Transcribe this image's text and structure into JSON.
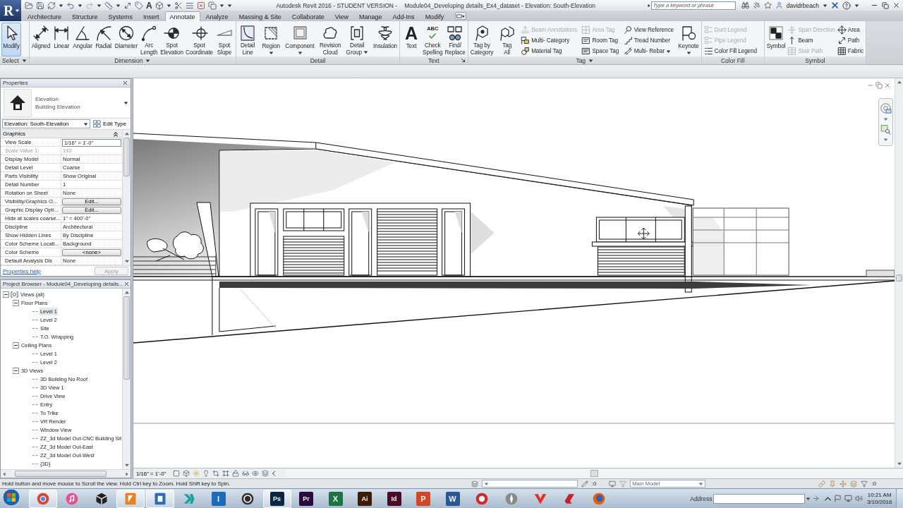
{
  "title_bar": {
    "app_glyph": "R",
    "text_tool_glyph": "A",
    "app_title": "Autodesk Revit 2016 - STUDENT VERSION -",
    "document_title": "Module04_Developing details_Ex4_dataset - Elevation: South-Elevation",
    "search": {
      "placeholder": "Type a keyword or phrase"
    },
    "user": "davidrbeach"
  },
  "tabs": [
    {
      "label": "Architecture",
      "selected": false
    },
    {
      "label": "Structure",
      "selected": false
    },
    {
      "label": "Systems",
      "selected": false
    },
    {
      "label": "Insert",
      "selected": false
    },
    {
      "label": "Annotate",
      "selected": true
    },
    {
      "label": "Analyze",
      "selected": false
    },
    {
      "label": "Massing & Site",
      "selected": false
    },
    {
      "label": "Collaborate",
      "selected": false
    },
    {
      "label": "View",
      "selected": false
    },
    {
      "label": "Manage",
      "selected": false
    },
    {
      "label": "Add-Ins",
      "selected": false
    },
    {
      "label": "Modify",
      "selected": false
    }
  ],
  "ribbon": [
    {
      "title": "Select",
      "menu": true,
      "buttons": [
        {
          "kind": "large",
          "label": "Modify",
          "pressed": true
        }
      ]
    },
    {
      "title": "Dimension",
      "menu": true,
      "buttons": [
        {
          "kind": "large",
          "label": "Aligned"
        },
        {
          "kind": "large",
          "label": "Linear"
        },
        {
          "kind": "large",
          "label": "Angular"
        },
        {
          "kind": "large",
          "label": "Radial"
        },
        {
          "kind": "large",
          "label": "Diameter"
        },
        {
          "kind": "large",
          "label": "Arc\nLength"
        },
        {
          "kind": "large",
          "label": "Spot\nElevation"
        },
        {
          "kind": "large",
          "label": "Spot\nCoordinate"
        },
        {
          "kind": "large",
          "label": "Spot\nSlope"
        }
      ]
    },
    {
      "title": "Detail",
      "buttons": [
        {
          "kind": "large",
          "label": "Detail\nLine"
        },
        {
          "kind": "large",
          "label": "Region",
          "dropdown": true
        },
        {
          "kind": "large",
          "label": "Component",
          "dropdown": true
        },
        {
          "kind": "large",
          "label": "Revision\nCloud"
        },
        {
          "kind": "large",
          "label": "Detail\nGroup",
          "dropdown": true
        },
        {
          "kind": "large",
          "label": "Insulation"
        }
      ]
    },
    {
      "title": "Text",
      "launcher": true,
      "buttons": [
        {
          "kind": "glyph",
          "glyph": "A",
          "label": "Text"
        },
        {
          "kind": "glyph",
          "glyph": "ABC",
          "label": "Check\nSpelling"
        },
        {
          "kind": "large",
          "label": "Find/\nReplace"
        }
      ]
    },
    {
      "title": "Tag",
      "menu": true,
      "buttons": [
        {
          "kind": "large",
          "label": "Tag by\nCategory",
          "disabled": false
        },
        {
          "kind": "large",
          "label": "Tag\nAll",
          "disabled": false
        },
        {
          "kind": "small",
          "label": "Beam Annotations",
          "disabled": true
        },
        {
          "kind": "small",
          "label": "Multi- Category",
          "disabled": false
        },
        {
          "kind": "small",
          "label": "Material Tag",
          "disabled": false
        },
        {
          "kind": "small",
          "label": "Area Tag",
          "disabled": true
        },
        {
          "kind": "small",
          "label": "Room Tag",
          "disabled": false
        },
        {
          "kind": "small",
          "label": "Space Tag",
          "disabled": false
        },
        {
          "kind": "small",
          "label": "View Reference",
          "disabled": false
        },
        {
          "kind": "small",
          "label": "Tread Number",
          "disabled": false
        },
        {
          "kind": "small",
          "label": "Multi- Rebar",
          "disabled": false,
          "dropdown": true
        },
        {
          "kind": "large",
          "label": "Keynote",
          "disabled": false,
          "dropdown": true
        }
      ]
    },
    {
      "title": "Color Fill",
      "buttons": [
        {
          "kind": "small",
          "label": "Duct Legend",
          "disabled": true
        },
        {
          "kind": "small",
          "label": "Pipe Legend",
          "disabled": true
        },
        {
          "kind": "small",
          "label": "Color Fill Legend",
          "disabled": false
        }
      ]
    },
    {
      "title": "Symbol",
      "buttons": [
        {
          "kind": "large",
          "label": "Symbol",
          "disabled": false
        },
        {
          "kind": "small",
          "label": "Span Direction",
          "disabled": true
        },
        {
          "kind": "small",
          "label": "Beam",
          "disabled": false
        },
        {
          "kind": "small",
          "label": "Stair Path",
          "disabled": true
        },
        {
          "kind": "small",
          "label": "Area",
          "disabled": false
        },
        {
          "kind": "small",
          "label": "Path",
          "disabled": false
        },
        {
          "kind": "small",
          "label": "Fabric",
          "disabled": false
        }
      ]
    }
  ],
  "properties": {
    "title": "Properties",
    "type_category": "Elevation",
    "type_name": "Building Elevation",
    "instance": "Elevation: South-Elevation",
    "edit_type": "Edit Type",
    "group": {
      "label": "Graphics",
      "expanded": true
    },
    "rows": [
      {
        "name": "View Scale",
        "value": "1/16\" = 1'-0\"",
        "kind": "field",
        "disabled": false
      },
      {
        "name": "Scale Value 1:",
        "value": "192",
        "kind": "text",
        "disabled": true
      },
      {
        "name": "Display Model",
        "value": "Normal",
        "kind": "text",
        "disabled": false
      },
      {
        "name": "Detail Level",
        "value": "Coarse",
        "kind": "text",
        "disabled": false
      },
      {
        "name": "Parts Visibility",
        "value": "Show Original",
        "kind": "text",
        "disabled": false
      },
      {
        "name": "Detail Number",
        "value": "1",
        "kind": "text",
        "disabled": false
      },
      {
        "name": "Rotation on Sheet",
        "value": "None",
        "kind": "text",
        "disabled": false
      },
      {
        "name": "Visibility/Graphics O...",
        "value": "Edit...",
        "kind": "button",
        "disabled": false
      },
      {
        "name": "Graphic Display Opti...",
        "value": "Edit...",
        "kind": "button",
        "disabled": false
      },
      {
        "name": "Hide at scales coarse...",
        "value": "1\" = 400'-0\"",
        "kind": "text",
        "disabled": false
      },
      {
        "name": "Discipline",
        "value": "Architectural",
        "kind": "text",
        "disabled": false
      },
      {
        "name": "Show Hidden Lines",
        "value": "By Discipline",
        "kind": "text",
        "disabled": false
      },
      {
        "name": "Color Scheme Locati...",
        "value": "Background",
        "kind": "text",
        "disabled": false
      },
      {
        "name": "Color Scheme",
        "value": "<none>",
        "kind": "button",
        "disabled": false
      },
      {
        "name": "Default Analysis Dis",
        "value": "None",
        "kind": "text",
        "disabled": false
      }
    ],
    "help": "Properties help",
    "apply": {
      "label": "Apply",
      "disabled": true
    }
  },
  "project_browser": {
    "title": "Project Browser - Module04_Developing details...",
    "tree": [
      {
        "label": "Views (all)",
        "expanded": true,
        "selected": false,
        "children": [
          {
            "label": "Floor Plans",
            "expanded": true,
            "selected": false,
            "children": [
              {
                "label": "Level 1",
                "selected": true
              },
              {
                "label": "Level 2",
                "selected": false
              },
              {
                "label": "Site",
                "selected": false
              },
              {
                "label": "T.O. Wrapping",
                "selected": false
              }
            ]
          },
          {
            "label": "Ceiling Plans",
            "expanded": true,
            "selected": false,
            "children": [
              {
                "label": "Level 1",
                "selected": false
              },
              {
                "label": "Level 2",
                "selected": false
              }
            ]
          },
          {
            "label": "3D Views",
            "expanded": true,
            "selected": false,
            "children": [
              {
                "label": "3D Building No Roof",
                "selected": false
              },
              {
                "label": "3D View 1",
                "selected": false
              },
              {
                "label": "Drive View",
                "selected": false
              },
              {
                "label": "Entry",
                "selected": false
              },
              {
                "label": "To Trike",
                "selected": false
              },
              {
                "label": "VR Render",
                "selected": false
              },
              {
                "label": "Window View",
                "selected": false
              },
              {
                "label": "ZZ_3d Model Out-CNC Building Sit",
                "selected": false
              },
              {
                "label": "ZZ_3d Model Out-East",
                "selected": false
              },
              {
                "label": "ZZ_3d Model Out-West",
                "selected": false
              },
              {
                "label": "{3D}",
                "selected": false
              }
            ]
          }
        ]
      }
    ]
  },
  "view": {
    "scale": "1/16\" = 1'-0\""
  },
  "status_bar": {
    "message": "Hold button and move mouse to Scroll the view. Hold Ctrl key to Zoom. Hold Shift key to Spin.",
    "editable_count": ":0",
    "active_model": "Main Model",
    "filter_count": ":0"
  },
  "taskbar": {
    "apps": [
      {
        "open": true,
        "color": "#db4437"
      },
      {
        "open": false,
        "color": "#e7508f"
      },
      {
        "open": false,
        "color": "#222222"
      },
      {
        "open": true,
        "color": "#e8821e"
      },
      {
        "open": true,
        "color": "#2d6db5"
      },
      {
        "open": false,
        "color": "#17a398"
      },
      {
        "open": false,
        "color": "#1c6bb8",
        "glyph": "I"
      },
      {
        "open": false,
        "color": "#302e31"
      },
      {
        "open": true,
        "color": "#0b2742",
        "glyph": "Ps"
      },
      {
        "open": false,
        "color": "#2b0a3d",
        "glyph": "Pr"
      },
      {
        "open": false,
        "color": "#1f7244",
        "glyph": "X"
      },
      {
        "open": false,
        "color": "#3d1c00",
        "glyph": "Ai"
      },
      {
        "open": false,
        "color": "#4b0a26",
        "glyph": "Id"
      },
      {
        "open": false,
        "color": "#d24726",
        "glyph": "P"
      },
      {
        "open": false,
        "color": "#2b5797",
        "glyph": "W"
      },
      {
        "open": false,
        "color": "#d7262b"
      },
      {
        "open": false,
        "color": "#8a8a8a"
      },
      {
        "open": false,
        "color": "#e0302a"
      },
      {
        "open": false,
        "color": "#c8202a"
      },
      {
        "open": false,
        "color": "#e66000"
      }
    ],
    "address_label": "Address",
    "time": "10:21 AM",
    "date": "3/10/2016"
  }
}
